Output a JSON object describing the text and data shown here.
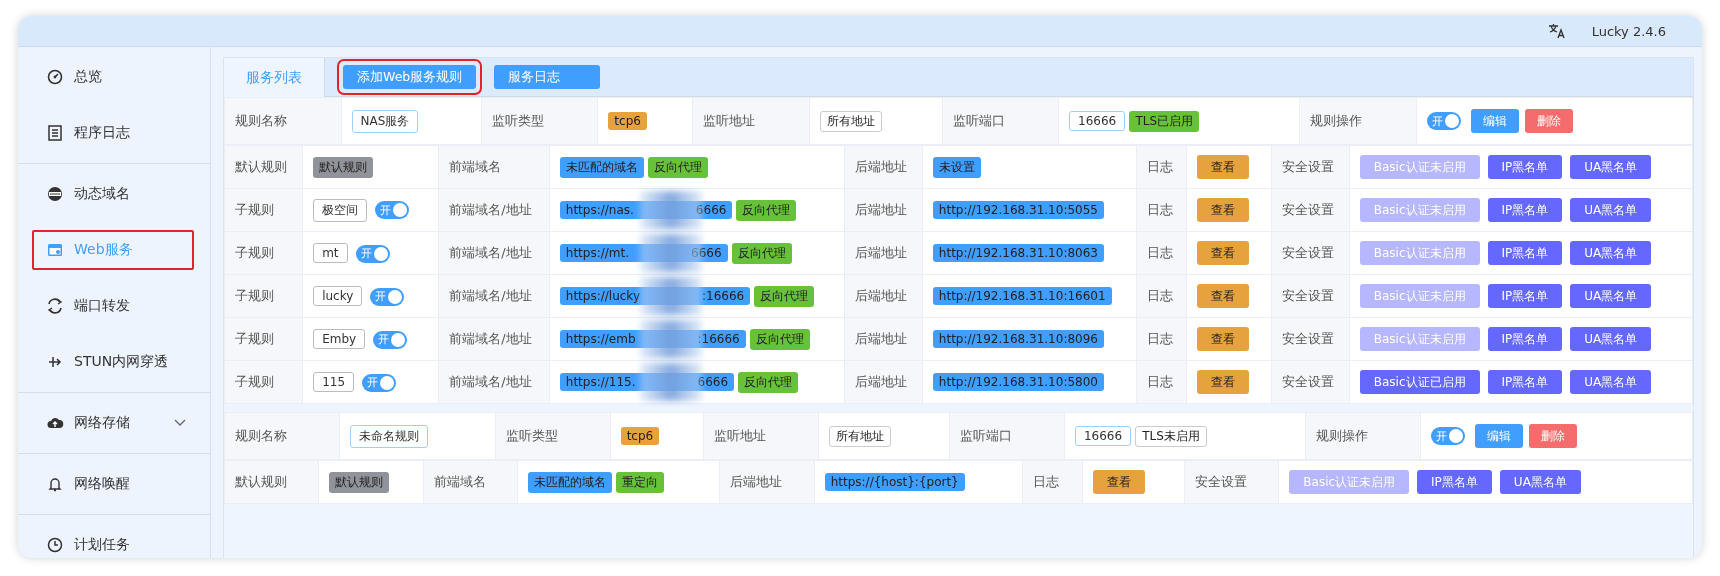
{
  "top_bar": {
    "version": "Lucky 2.4.6"
  },
  "sidebar": {
    "groups": [
      [
        {
          "label": "总览",
          "selected": false,
          "highlighted": false
        },
        {
          "label": "程序日志",
          "selected": false,
          "highlighted": false
        }
      ],
      [
        {
          "label": "动态域名",
          "selected": false,
          "highlighted": false
        },
        {
          "label": "Web服务",
          "selected": true,
          "highlighted": true
        },
        {
          "label": "端口转发",
          "selected": false,
          "highlighted": false
        },
        {
          "label": "STUN内网穿透",
          "selected": false,
          "highlighted": false
        }
      ],
      [
        {
          "label": "网络存储",
          "selected": false,
          "highlighted": false,
          "expanded": false
        }
      ],
      [
        {
          "label": "网络唤醒",
          "selected": false,
          "highlighted": false
        }
      ],
      [
        {
          "label": "计划任务",
          "selected": false,
          "highlighted": false
        }
      ]
    ]
  },
  "tabs": [
    {
      "label": "服务列表",
      "selected": true
    }
  ],
  "buttons": [
    {
      "label": "添加Web服务规则",
      "highlighted": true
    },
    {
      "label": "服务日志",
      "highlighted": false
    }
  ],
  "rules": [
    {
      "header": {
        "labels": [
          "规则名称",
          "监听类型",
          "监听地址",
          "监听端口",
          "规则操作"
        ],
        "name": "NAS服务",
        "listen_type": "tcp6",
        "listen_address": "所有地址",
        "port": "16666",
        "tls": {
          "label": "TLS已启用",
          "enabled": true
        },
        "switch": {
          "label": "开",
          "on": true
        },
        "edit": "编辑",
        "delete": "删除"
      },
      "rows": [
        {
          "kind": "default",
          "label": "默认规则",
          "name": "默认规则",
          "frontend_label": "前端域名",
          "frontend": {
            "text": "未匹配的域名",
            "blurred": false
          },
          "mode": "反向代理",
          "backend_label": "后端地址",
          "backend": "未设置",
          "log_label": "日志",
          "log_button": "查看",
          "security_label": "安全设置",
          "basic_auth": {
            "label": "Basic认证未启用",
            "enabled": false
          },
          "ip_blacklist": "IP黑名单",
          "ua_blacklist": "UA黑名单"
        },
        {
          "kind": "sub",
          "label": "子规则",
          "name": "极空间",
          "switch": {
            "label": "开",
            "on": true
          },
          "frontend_label": "前端域名/地址",
          "frontend": {
            "text": "https://nas.",
            "tail": "6666",
            "blurred": true
          },
          "mode": "反向代理",
          "backend_label": "后端地址",
          "backend": "http://192.168.31.10:5055",
          "log_label": "日志",
          "log_button": "查看",
          "security_label": "安全设置",
          "basic_auth": {
            "label": "Basic认证未启用",
            "enabled": false
          },
          "ip_blacklist": "IP黑名单",
          "ua_blacklist": "UA黑名单"
        },
        {
          "kind": "sub",
          "label": "子规则",
          "name": "mt",
          "switch": {
            "label": "开",
            "on": true
          },
          "frontend_label": "前端域名/地址",
          "frontend": {
            "text": "https://mt.",
            "tail": "6666",
            "blurred": true
          },
          "mode": "反向代理",
          "backend_label": "后端地址",
          "backend": "http://192.168.31.10:8063",
          "log_label": "日志",
          "log_button": "查看",
          "security_label": "安全设置",
          "basic_auth": {
            "label": "Basic认证未启用",
            "enabled": false
          },
          "ip_blacklist": "IP黑名单",
          "ua_blacklist": "UA黑名单"
        },
        {
          "kind": "sub",
          "label": "子规则",
          "name": "lucky",
          "switch": {
            "label": "开",
            "on": true
          },
          "frontend_label": "前端域名/地址",
          "frontend": {
            "text": "https://lucky",
            "tail": ":16666",
            "blurred": true
          },
          "mode": "反向代理",
          "backend_label": "后端地址",
          "backend": "http://192.168.31.10:16601",
          "log_label": "日志",
          "log_button": "查看",
          "security_label": "安全设置",
          "basic_auth": {
            "label": "Basic认证未启用",
            "enabled": false
          },
          "ip_blacklist": "IP黑名单",
          "ua_blacklist": "UA黑名单"
        },
        {
          "kind": "sub",
          "label": "子规则",
          "name": "Emby",
          "switch": {
            "label": "开",
            "on": true
          },
          "frontend_label": "前端域名/地址",
          "frontend": {
            "text": "https://emb",
            "tail": ":16666",
            "blurred": true
          },
          "mode": "反向代理",
          "backend_label": "后端地址",
          "backend": "http://192.168.31.10:8096",
          "log_label": "日志",
          "log_button": "查看",
          "security_label": "安全设置",
          "basic_auth": {
            "label": "Basic认证未启用",
            "enabled": false
          },
          "ip_blacklist": "IP黑名单",
          "ua_blacklist": "UA黑名单"
        },
        {
          "kind": "sub",
          "label": "子规则",
          "name": "115",
          "switch": {
            "label": "开",
            "on": true
          },
          "frontend_label": "前端域名/地址",
          "frontend": {
            "text": "https://115.",
            "tail": "6666",
            "blurred": true
          },
          "mode": "反向代理",
          "backend_label": "后端地址",
          "backend": "http://192.168.31.10:5800",
          "log_label": "日志",
          "log_button": "查看",
          "security_label": "安全设置",
          "basic_auth": {
            "label": "Basic认证已启用",
            "enabled": true
          },
          "ip_blacklist": "IP黑名单",
          "ua_blacklist": "UA黑名单"
        }
      ]
    },
    {
      "header": {
        "labels": [
          "规则名称",
          "监听类型",
          "监听地址",
          "监听端口",
          "规则操作"
        ],
        "name": "未命名规则",
        "listen_type": "tcp6",
        "listen_address": "所有地址",
        "port": "16666",
        "tls": {
          "label": "TLS未启用",
          "enabled": false
        },
        "switch": {
          "label": "开",
          "on": true
        },
        "edit": "编辑",
        "delete": "删除"
      },
      "rows": [
        {
          "kind": "default",
          "label": "默认规则",
          "name": "默认规则",
          "frontend_label": "前端域名",
          "frontend": {
            "text": "未匹配的域名",
            "blurred": false
          },
          "mode": "重定向",
          "backend_label": "后端地址",
          "backend": "https://{host}:{port}",
          "log_label": "日志",
          "log_button": "查看",
          "security_label": "安全设置",
          "basic_auth": {
            "label": "Basic认证未启用",
            "enabled": false
          },
          "ip_blacklist": "IP黑名单",
          "ua_blacklist": "UA黑名单"
        }
      ]
    }
  ]
}
